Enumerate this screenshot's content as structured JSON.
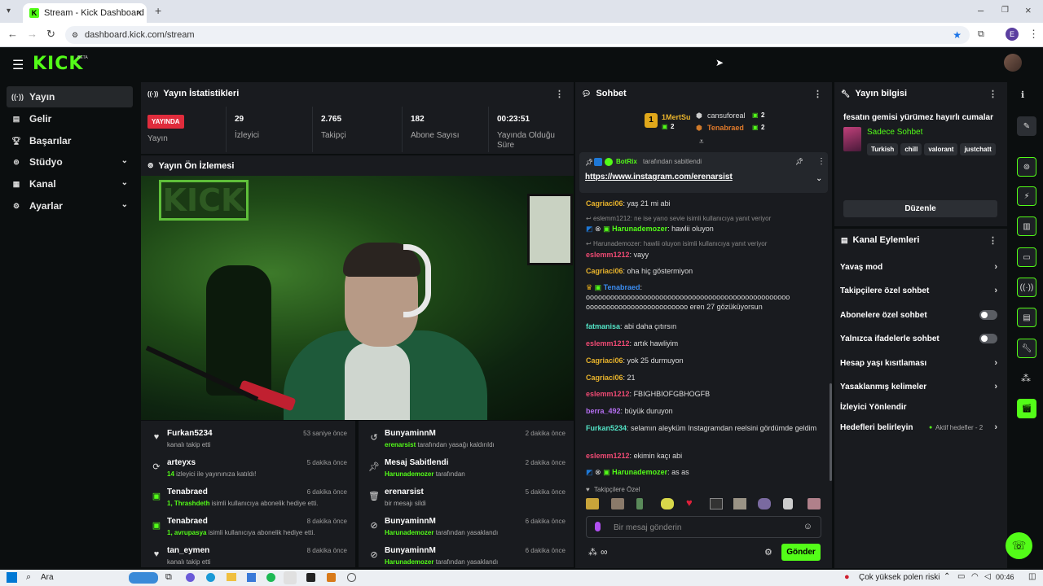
{
  "browser": {
    "tab_title": "Stream - Kick Dashboard",
    "url": "dashboard.kick.com/stream",
    "profile_initial": "E"
  },
  "sidebar": {
    "items": [
      {
        "label": "Yayın"
      },
      {
        "label": "Gelir"
      },
      {
        "label": "Başarılar"
      },
      {
        "label": "Stüdyo"
      },
      {
        "label": "Kanal"
      },
      {
        "label": "Ayarlar"
      }
    ]
  },
  "stats": {
    "title": "Yayın İstatistikleri",
    "live_badge": "YAYINDA",
    "live_label": "Yayın",
    "viewers": "29",
    "viewers_label": "İzleyici",
    "followers": "2.765",
    "followers_label": "Takipçi",
    "subs": "182",
    "subs_label": "Abone Sayısı",
    "duration": "00:23:51",
    "duration_label": "Yayında Olduğu Süre"
  },
  "preview": {
    "title": "Yayın Ön İzlemesi"
  },
  "feed_left": [
    {
      "name": "Furkan5234",
      "time": "53 saniye önce",
      "desc": "kanalı takip etti"
    },
    {
      "name": "arteyxs",
      "time": "5 dakika önce",
      "hl": "14",
      "desc": " izleyici ile yayınınıza katıldı!"
    },
    {
      "name": "Tenabraed",
      "time": "6 dakika önce",
      "hl": "1, Thrashdeth",
      "desc": " isimli kullanıcıya abonelik hediye etti."
    },
    {
      "name": "Tenabraed",
      "time": "8 dakika önce",
      "hl": "1, avrupasya",
      "desc": " isimli kullanıcıya abonelik hediye etti."
    },
    {
      "name": "tan_eymen",
      "time": "8 dakika önce",
      "desc": "kanalı takip etti"
    }
  ],
  "feed_right": [
    {
      "name": "BunyaminnM",
      "time": "2 dakika önce",
      "hl": "erenarsist",
      "desc": " tarafından yasağı kaldırıldı"
    },
    {
      "name": "Mesaj Sabitlendi",
      "time": "2 dakika önce",
      "hl": "Harunademozer",
      "desc": " tarafından"
    },
    {
      "name": "erenarsist",
      "time": "5 dakika önce",
      "desc": "bir mesajı sildi"
    },
    {
      "name": "BunyaminnM",
      "time": "6 dakika önce",
      "hl": "Harunademozer",
      "desc": " tarafından yasaklandı"
    },
    {
      "name": "BunyaminnM",
      "time": "6 dakika önce",
      "hl": "Harunademozer",
      "desc": " tarafından yasaklandı"
    }
  ],
  "chat": {
    "title": "Sohbet",
    "top1_name": "1MertSu",
    "top1_count": "2",
    "top2_name": "cansuforeal",
    "top2_count": "2",
    "top3_name": "Tenabraed",
    "top3_count": "2",
    "pinned_by": "BotRix",
    "pinned_suffix": "tarafından sabitlendi",
    "pinned_link": "https://www.instagram.com/erenarsist",
    "messages": [
      {
        "user": "Cagriaci06",
        "text": "yaş 21 mi abi"
      },
      {
        "reply": "eslemm1212: ne ise yarıo sevie isimli kullanıcıya yanıt veriyor"
      },
      {
        "user": "Harunademozer",
        "text": "hawlii oluyon"
      },
      {
        "reply": "Harunademozer: hawlii oluyon isimli kullanıcıya yanıt veriyor"
      },
      {
        "user": "eslemm1212",
        "text": "vayy"
      },
      {
        "user": "Cagriaci06",
        "text": "oha hiç göstermiyon"
      },
      {
        "user": "Tenabraed",
        "text": "oooooooooooooooooooooooooooooooooooooooooooooooooo ooooooooooooooooooooooooo eren 27 gözüküyorsun"
      },
      {
        "user": "fatmanisa",
        "text": "abi daha çıtırsın"
      },
      {
        "user": "eslemm1212",
        "text": "artık hawliyim"
      },
      {
        "user": "Cagriaci06",
        "text": "yok 25 durmuyon"
      },
      {
        "user": "Cagriaci06",
        "text": "21"
      },
      {
        "user": "eslemm1212",
        "text": "FBIGHBIOFGBHOGFB"
      },
      {
        "user": "berra_492",
        "text": "büyük duruyon"
      },
      {
        "user": "Furkan5234",
        "text": "selamın aleyküm Instagramdan reelsini gördümde geldim"
      },
      {
        "user": "eslemm1212",
        "text": "ekimin kaçı abi"
      },
      {
        "user": "Harunademozer",
        "text": "as as"
      }
    ],
    "emote_label": "Takipçilere Özel",
    "input_placeholder": "Bir mesaj gönderin",
    "send": "Gönder"
  },
  "info": {
    "title": "Yayın bilgisi",
    "stream_title": "fesatın gemisi yürümez hayırlı cumalar",
    "category": "Sadece Sohbet",
    "tags": [
      "Turkish",
      "chill",
      "valorant",
      "justchatt"
    ],
    "edit": "Düzenle"
  },
  "actions": {
    "title": "Kanal Eylemleri",
    "items": [
      {
        "label": "Yavaş mod"
      },
      {
        "label": "Takipçilere özel sohbet"
      },
      {
        "label": "Abonelere özel sohbet"
      },
      {
        "label": "Yalnızca ifadelerle sohbet"
      },
      {
        "label": "Hesap yaşı kısıtlaması"
      },
      {
        "label": "Yasaklanmış kelimeler"
      },
      {
        "label": "İzleyici Yönlendir"
      },
      {
        "label": "Hedefleri belirleyin"
      }
    ],
    "goals_active": "Aktif hedefler - 2"
  },
  "taskbar": {
    "search": "Ara",
    "weather": "Çok yüksek polen riski",
    "time": "00:46"
  },
  "colors": {
    "accent": "#53fc18",
    "panel": "#191b1f",
    "bg": "#0b0e0f"
  }
}
